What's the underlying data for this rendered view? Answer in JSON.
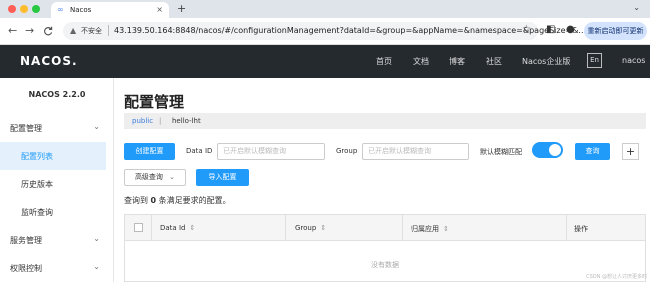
{
  "browser": {
    "tab_title": "Nacos",
    "tab_close": "×",
    "new_tab": "+",
    "tab_menu": "⌄",
    "back": "←",
    "forward": "→",
    "reload": "C",
    "security_label": "不安全",
    "url": "43.139.50.164:8848/nacos/#/configurationManagement?dataId=&group=&appName=&namespace=&pageSize=&...",
    "relaunch_label": "重新启动即可更新",
    "colors": {
      "close": "#ff5f57",
      "minimize": "#febc2e",
      "maximize": "#28c840"
    }
  },
  "topnav": {
    "logo": "NACOS.",
    "links": [
      "首页",
      "文档",
      "博客",
      "社区",
      "Nacos企业版"
    ],
    "lang": "En",
    "right": "nacos"
  },
  "sidebar": {
    "version": "NACOS 2.2.0",
    "items": [
      {
        "label": "配置管理",
        "type": "group"
      },
      {
        "label": "配置列表",
        "type": "sub",
        "active": true
      },
      {
        "label": "历史版本",
        "type": "sub"
      },
      {
        "label": "监听查询",
        "type": "sub"
      },
      {
        "label": "服务管理",
        "type": "group"
      },
      {
        "label": "权限控制",
        "type": "group"
      }
    ]
  },
  "main": {
    "title": "配置管理",
    "namespace": "public",
    "crumb_sep": "|",
    "namespace_id": "hello-lht",
    "create_button": "创建配置",
    "dataid_label": "Data ID",
    "dataid_placeholder": "已开启默认模糊查询",
    "group_label": "Group",
    "group_placeholder": "已开启默认模糊查询",
    "fuzzy_label": "默认模糊匹配",
    "fuzzy_on": true,
    "query_button": "查询",
    "add_icon": "+",
    "advanced_button": "高级查询",
    "advanced_chevron": "⌄",
    "import_button": "导入配置",
    "result_prefix": "查询到",
    "result_count": "0",
    "result_suffix": "条满足要求的配置。",
    "table": {
      "columns": [
        "Data Id",
        "Group",
        "归属应用",
        "操作"
      ],
      "sort_icon": "⇕",
      "empty": "没有数据"
    }
  },
  "watermark": "CSDN @想让人讨厌更多时",
  "accent_color": "#209bfa"
}
